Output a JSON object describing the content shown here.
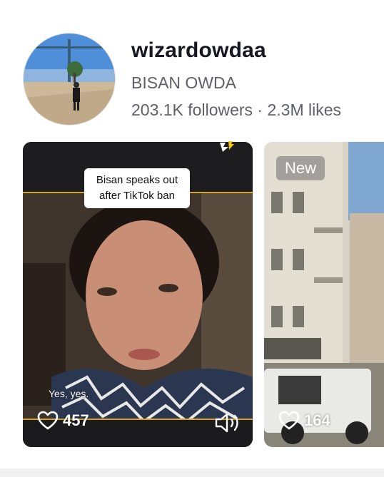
{
  "profile": {
    "username": "wizardowdaa",
    "display_name": "BISAN OWDA",
    "stats": "203.1K followers · 2.3M likes",
    "avatar_icon": "profile-avatar"
  },
  "videos": [
    {
      "caption": "Bisan speaks out after TikTok ban",
      "subtitle": "Yes, yes.",
      "likes": "457",
      "like_icon": "heart-outline-icon",
      "sound_icon": "speaker-icon"
    },
    {
      "badge": "New",
      "likes": "164",
      "like_icon": "heart-outline-icon"
    }
  ],
  "colors": {
    "text_primary": "#161823",
    "text_secondary": "#5f6068",
    "accent_yellow": "#f5c518"
  }
}
